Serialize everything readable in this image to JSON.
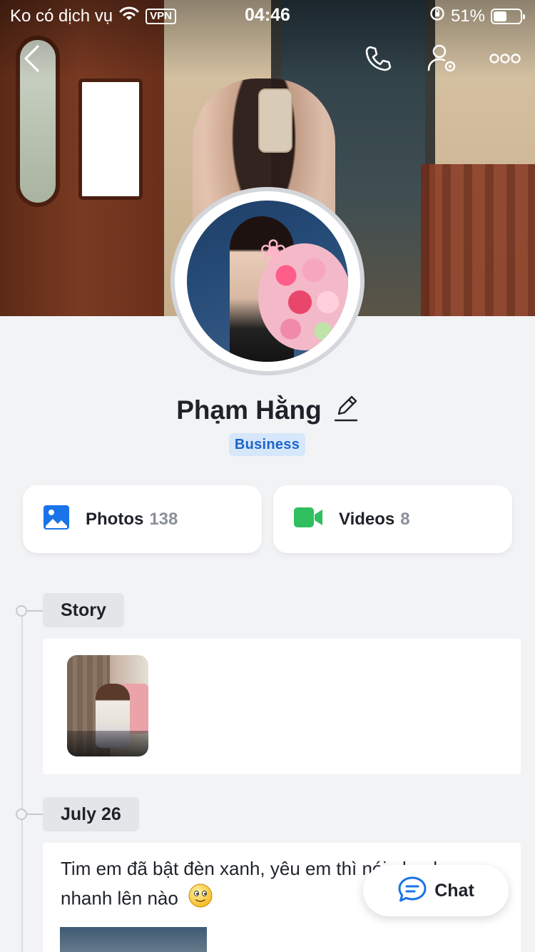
{
  "status_bar": {
    "carrier": "Ko có dịch vụ",
    "vpn": "VPN",
    "time": "04:46",
    "battery": "51%",
    "battery_level": 0.51
  },
  "profile": {
    "name": "Phạm Hằng",
    "badge": "Business"
  },
  "media": {
    "photos_label": "Photos",
    "photos_count": "138",
    "videos_label": "Videos",
    "videos_count": "8"
  },
  "timeline": {
    "story_tag": "Story",
    "post_date": "July 26",
    "post_text": "Tim em đã bật đèn xanh, yêu em thì nói nhanh nhanh lên nào"
  },
  "chat": {
    "label": "Chat"
  },
  "icons": {
    "back": "chevron-left-icon",
    "call": "phone-icon",
    "settings": "user-settings-icon",
    "more": "more-dots-icon",
    "photos": "image-icon",
    "videos": "video-camera-icon",
    "chat": "chat-bubble-icon",
    "edit": "pencil-icon"
  },
  "colors": {
    "badge_bg": "#d6e7fb",
    "badge_text": "#1c64c8",
    "photos_icon": "#1a73e8",
    "videos_icon": "#2fbf5f",
    "chat_icon": "#1a73e8"
  }
}
